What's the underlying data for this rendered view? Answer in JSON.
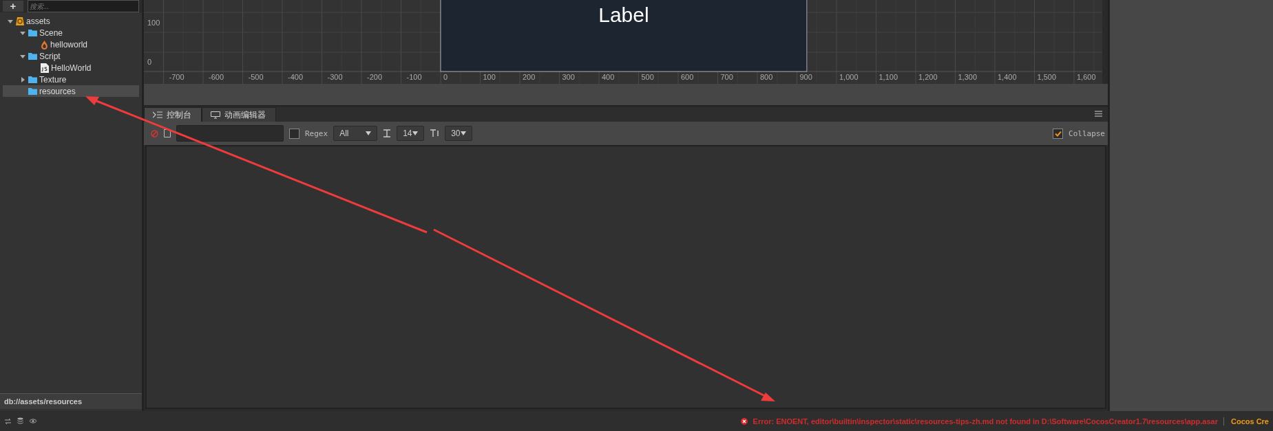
{
  "assets_panel": {
    "add_button": "+",
    "search": {
      "placeholder": "搜索..."
    },
    "tree": [
      {
        "label": "assets",
        "kind": "db",
        "expanded": true,
        "selected": false,
        "children": [
          {
            "label": "Scene",
            "kind": "folder",
            "expanded": true,
            "selected": false,
            "children": [
              {
                "label": "helloworld",
                "kind": "scene",
                "selected": false
              }
            ]
          },
          {
            "label": "Script",
            "kind": "folder",
            "expanded": true,
            "selected": false,
            "children": [
              {
                "label": "HelloWorld",
                "kind": "script",
                "selected": false
              }
            ]
          },
          {
            "label": "Texture",
            "kind": "folder",
            "expanded": false,
            "selected": false
          },
          {
            "label": "resources",
            "kind": "folder",
            "selected": true
          }
        ]
      }
    ],
    "path": "db://assets/resources"
  },
  "scene": {
    "canvas_label": "Label",
    "y_ticks": [
      "100",
      "0"
    ],
    "x_ticks": [
      "-700",
      "-600",
      "-500",
      "-400",
      "-300",
      "-200",
      "-100",
      "0",
      "100",
      "200",
      "300",
      "400",
      "500",
      "600",
      "700",
      "800",
      "900",
      "1,000",
      "1,100",
      "1,200",
      "1,300",
      "1,400",
      "1,500",
      "1,600"
    ]
  },
  "console": {
    "tabs": [
      {
        "label": "控制台",
        "kind": "console",
        "selected": true
      },
      {
        "label": "动画编辑器",
        "kind": "animation",
        "selected": false
      }
    ],
    "regex": {
      "label": "Regex",
      "checked": false
    },
    "level_select": "All",
    "font_size": "14",
    "line_count": "30",
    "collapse": {
      "label": "Collapse",
      "checked": true
    }
  },
  "status_bar": {
    "error": "Error: ENOENT, editor\\builtin\\inspector\\static\\resources-tips-zh.md not found in D:\\Software\\CocosCreator1.7\\resources\\app.asar",
    "brand": "Cocos Cre"
  }
}
